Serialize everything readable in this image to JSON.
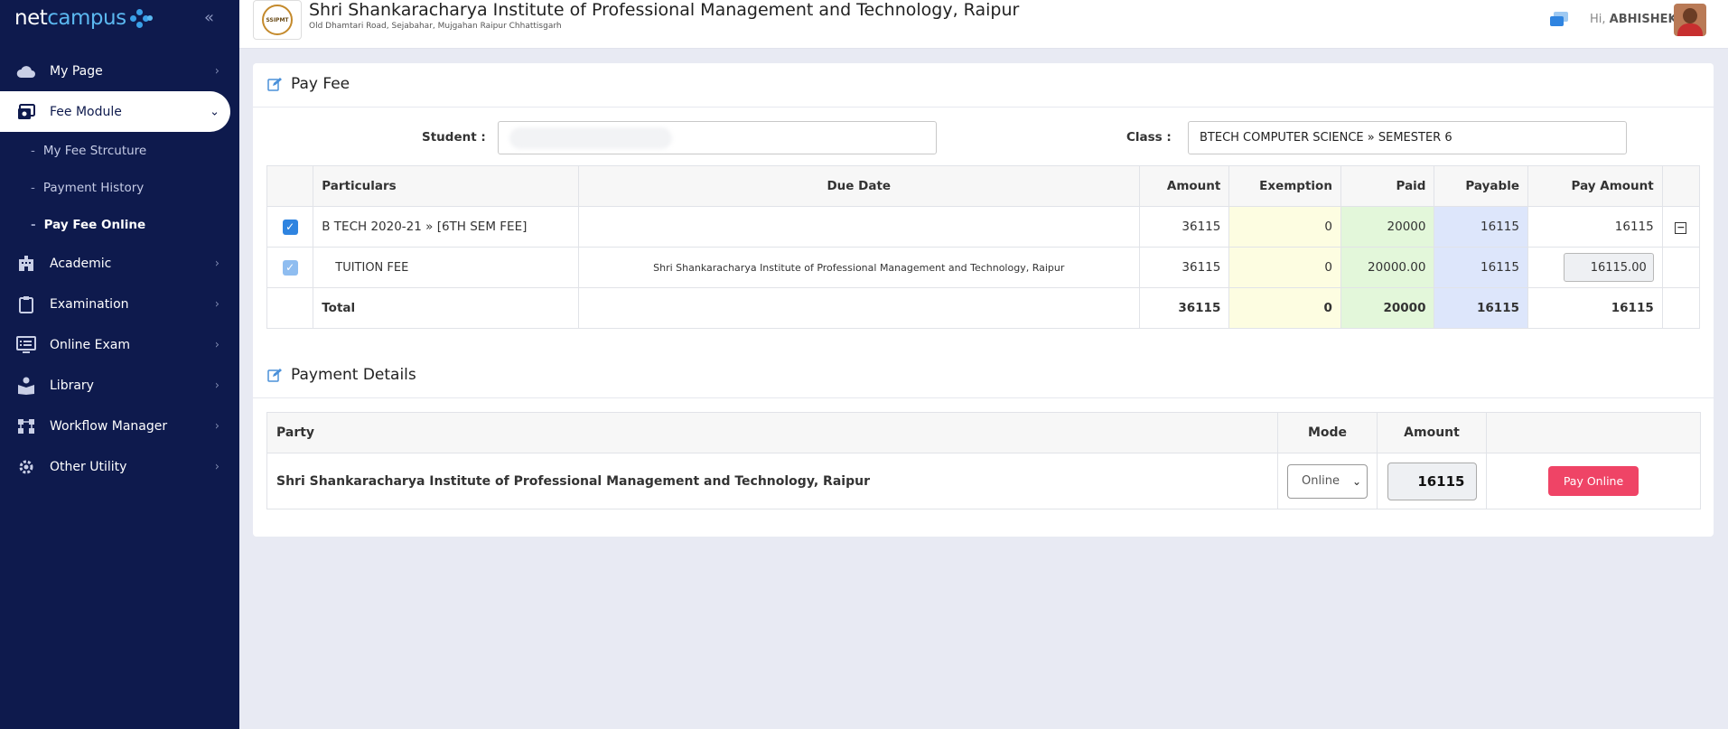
{
  "brand": {
    "net": "net",
    "campus": "campus"
  },
  "sidebar": {
    "items": [
      {
        "label": "My Page",
        "icon": "cloud-icon"
      },
      {
        "label": "Fee Module",
        "icon": "money-icon"
      },
      {
        "label": "Academic",
        "icon": "building-icon"
      },
      {
        "label": "Examination",
        "icon": "clipboard-icon"
      },
      {
        "label": "Online Exam",
        "icon": "monitor-icon"
      },
      {
        "label": "Library",
        "icon": "book-reader-icon"
      },
      {
        "label": "Workflow Manager",
        "icon": "workflow-icon"
      },
      {
        "label": "Other Utility",
        "icon": "gear-icon"
      }
    ],
    "fee_submenu": [
      "My Fee Strcuture",
      "Payment History",
      "Pay Fee Online"
    ]
  },
  "header": {
    "institute_name": "Shri Shankaracharya Institute of Professional Management and Technology, Raipur",
    "institute_address": "Old Dhamtari Road, Sejabahar, Mujgahan Raipur Chhattisgarh",
    "logo_text": "SSIPMT",
    "greeting_prefix": "Hi, ",
    "user_name": "ABHISHEK"
  },
  "pay_fee": {
    "title": "Pay Fee",
    "student_label": "Student :",
    "student_value": "",
    "class_label": "Class :",
    "class_value": "BTECH COMPUTER SCIENCE » SEMESTER 6",
    "columns": [
      "Particulars",
      "Due Date",
      "Amount",
      "Exemption",
      "Paid",
      "Payable",
      "Pay Amount"
    ],
    "rows": [
      {
        "particular": "B TECH 2020-21 » [6TH SEM FEE]",
        "due_date": "",
        "amount": "36115",
        "exemption": "0",
        "paid": "20000",
        "payable": "16115",
        "pay_amount": "16115"
      },
      {
        "particular": "TUITION FEE",
        "due_date": "Shri Shankaracharya Institute of Professional Management and Technology, Raipur",
        "amount": "36115",
        "exemption": "0",
        "paid": "20000.00",
        "payable": "16115",
        "pay_amount": "16115.00"
      }
    ],
    "total": {
      "label": "Total",
      "amount": "36115",
      "exemption": "0",
      "paid": "20000",
      "payable": "16115",
      "pay_amount": "16115"
    }
  },
  "payment_details": {
    "title": "Payment Details",
    "columns": [
      "Party",
      "Mode",
      "Amount",
      ""
    ],
    "row": {
      "party": "Shri Shankaracharya Institute of Professional Management and Technology, Raipur",
      "mode": "Online",
      "amount": "16115",
      "button": "Pay Online"
    }
  },
  "colors": {
    "sidebar": "#0e1a4d",
    "accent": "#2f84e0",
    "pay_button": "#ef4466",
    "exemption_bg": "#fdfde1",
    "paid_bg": "#e3f7da",
    "payable_bg": "#dde6fb"
  }
}
